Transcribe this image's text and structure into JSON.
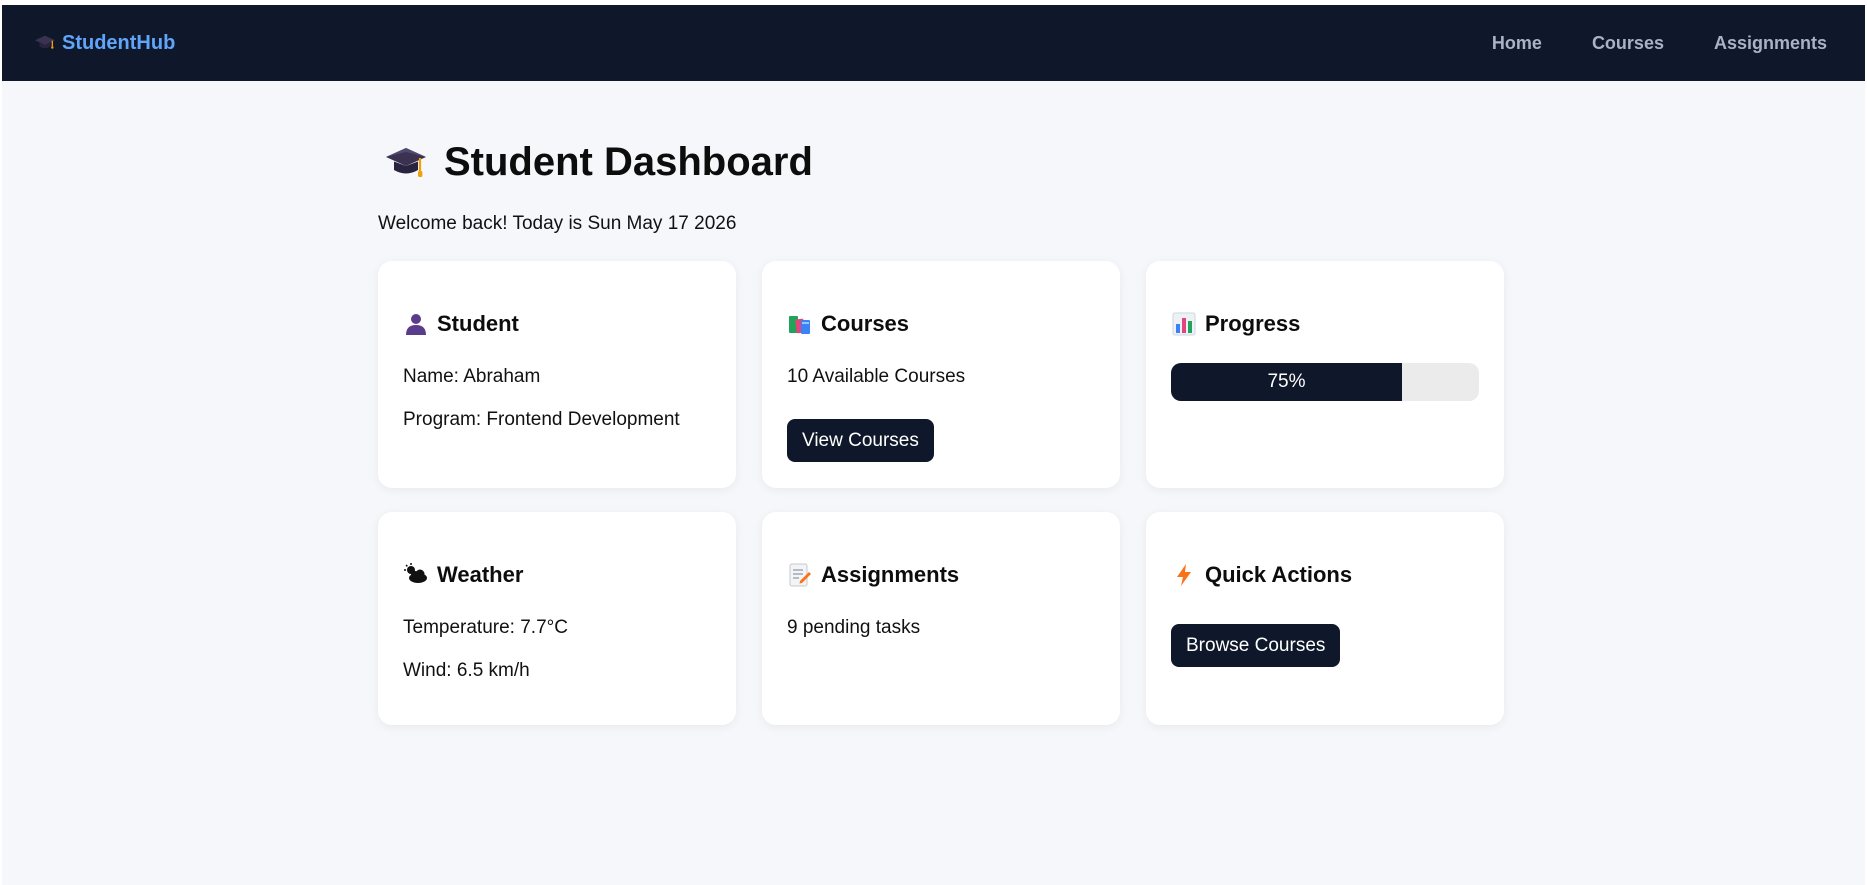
{
  "navbar": {
    "brand": "StudentHub",
    "brand_icon": "graduation-cap-icon",
    "links": [
      "Home",
      "Courses",
      "Assignments"
    ]
  },
  "header": {
    "title": "Student Dashboard",
    "icon": "graduation-cap-icon",
    "welcome_prefix": "Welcome back! Today is ",
    "date": "Sun May 17 2026"
  },
  "cards": {
    "student": {
      "title": "Student",
      "icon": "user-icon",
      "name_label": "Name: ",
      "name": "Abraham",
      "program_label": "Program: ",
      "program": "Frontend Development"
    },
    "courses": {
      "title": "Courses",
      "icon": "books-icon",
      "count_text": "10 Available Courses",
      "button": "View Courses"
    },
    "progress": {
      "title": "Progress",
      "icon": "bar-chart-icon",
      "percent": 75,
      "label": "75%"
    },
    "weather": {
      "title": "Weather",
      "icon": "cloud-sun-icon",
      "temperature_label": "Temperature: ",
      "temperature": "7.7°C",
      "wind_label": "Wind: ",
      "wind": "6.5 km/h"
    },
    "assignments": {
      "title": "Assignments",
      "icon": "memo-icon",
      "pending_text": "9 pending tasks"
    },
    "quick_actions": {
      "title": "Quick Actions",
      "icon": "lightning-icon",
      "button": "Browse Courses"
    }
  },
  "colors": {
    "navbar_bg": "#0f172a",
    "brand": "#60a5fa",
    "nav_link": "#a8b3c7",
    "page_bg": "#f5f7fb",
    "button_bg": "#0f172a",
    "progress_track": "#ebebeb"
  }
}
